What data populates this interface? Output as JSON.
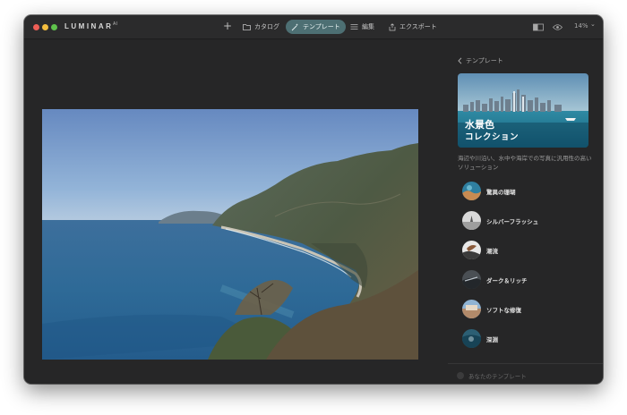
{
  "app": {
    "name": "LUMINAR",
    "name_suffix": "AI"
  },
  "toolbar": {
    "add_icon": "+",
    "tabs": [
      {
        "label": "カタログ",
        "icon": "folder-icon"
      },
      {
        "label": "テンプレート",
        "icon": "wand-icon",
        "active": true
      },
      {
        "label": "編集",
        "icon": "sliders-icon"
      },
      {
        "label": "エクスポート",
        "icon": "export-icon"
      }
    ],
    "zoom": "14%",
    "zoom_chevron": "⌄"
  },
  "panel": {
    "back_label": "テンプレート",
    "collection_title": "水景色",
    "collection_subtitle": "コレクション",
    "description": "海辺や川沿い、水中や海岸での写真に汎用性の高いソリューション",
    "templates": [
      {
        "label": "驚異の珊瑚"
      },
      {
        "label": "シルバーフラッシュ"
      },
      {
        "label": "潮流"
      },
      {
        "label": "ダーク＆リッチ"
      },
      {
        "label": "ソフトな修復"
      },
      {
        "label": "深淵"
      }
    ],
    "your_templates": "あなたのテンプレート"
  },
  "colors": {
    "window_bg": "#262627",
    "accent_tab": "#4d6f73"
  }
}
